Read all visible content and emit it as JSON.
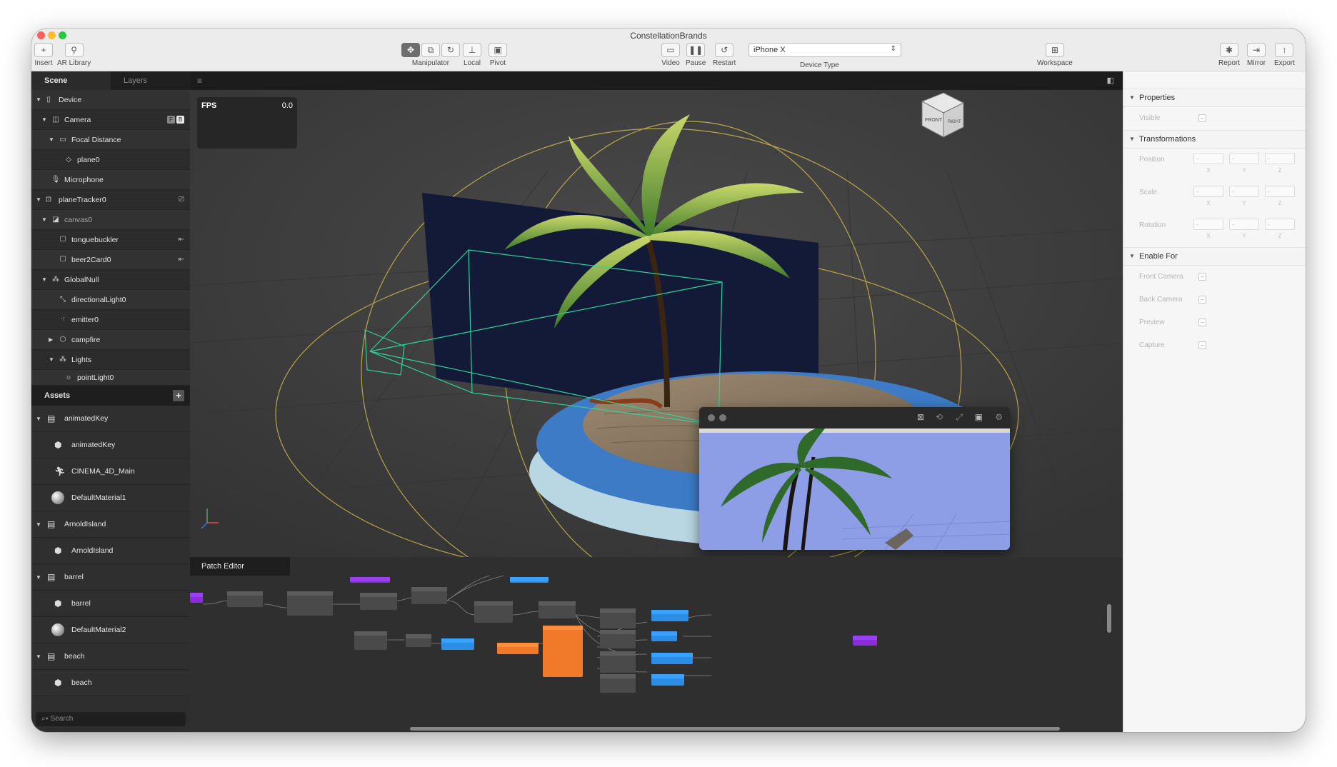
{
  "window": {
    "title": "ConstellationBrands"
  },
  "toolbar": {
    "insert": "Insert",
    "ar_library": "AR Library",
    "manipulator": "Manipulator",
    "local": "Local",
    "pivot": "Pivot",
    "video": "Video",
    "pause": "Pause",
    "restart": "Restart",
    "device_type_label": "Device Type",
    "device_type_value": "iPhone X",
    "workspace": "Workspace",
    "report": "Report",
    "mirror": "Mirror",
    "export": "Export"
  },
  "scene_panel": {
    "tabs": [
      "Scene",
      "Layers"
    ],
    "items": [
      {
        "label": "Device"
      },
      {
        "label": "Camera"
      },
      {
        "label": "Focal Distance"
      },
      {
        "label": "plane0"
      },
      {
        "label": "Microphone"
      },
      {
        "label": "planeTracker0"
      },
      {
        "label": "canvas0"
      },
      {
        "label": "tonguebuckler"
      },
      {
        "label": "beer2Card0"
      },
      {
        "label": "GlobalNull"
      },
      {
        "label": "directionalLight0"
      },
      {
        "label": "emitter0"
      },
      {
        "label": "campfire"
      },
      {
        "label": "Lights"
      },
      {
        "label": "pointLight0"
      }
    ],
    "camera_badges": [
      "F",
      "B"
    ]
  },
  "assets_panel": {
    "title": "Assets",
    "items": [
      {
        "label": "animatedKey"
      },
      {
        "label": "animatedKey"
      },
      {
        "label": "CINEMA_4D_Main"
      },
      {
        "label": "DefaultMaterial1"
      },
      {
        "label": "ArnoldIsland"
      },
      {
        "label": "ArnoldIsland"
      },
      {
        "label": "barrel"
      },
      {
        "label": "barrel"
      },
      {
        "label": "DefaultMaterial2"
      },
      {
        "label": "beach"
      },
      {
        "label": "beach"
      }
    ],
    "search_placeholder": "Search"
  },
  "viewport": {
    "fps_label": "FPS",
    "fps_value": "0.0",
    "gizmo_front": "FRONT",
    "gizmo_right": "RIGHT"
  },
  "patch_editor": {
    "tab": "Patch Editor"
  },
  "properties": {
    "properties_header": "Properties",
    "visible_label": "Visible",
    "transformations_header": "Transformations",
    "position_label": "Position",
    "scale_label": "Scale",
    "rotation_label": "Rotation",
    "axes": [
      "X",
      "Y",
      "Z"
    ],
    "enable_for_header": "Enable For",
    "front_camera": "Front Camera",
    "back_camera": "Back Camera",
    "preview": "Preview",
    "capture": "Capture"
  },
  "colors": {
    "patch_orange": "#f07a2a",
    "patch_blue": "#2b8ee6",
    "patch_purple": "#8a2cd8",
    "frustum_green": "#2fd39a",
    "wire_yellow": "#c7b04a",
    "preview_sky": "#8e9ee6"
  }
}
